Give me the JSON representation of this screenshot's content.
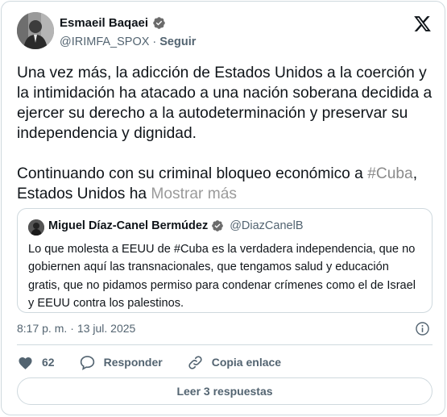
{
  "author": {
    "display_name": "Esmaeil Baqaei",
    "handle": "@IRIMFA_SPOX",
    "separator": "·",
    "follow_label": "Seguir"
  },
  "tweet": {
    "para1": "Una vez más, la adicción de Estados Unidos a la coerción y la intimidación ha atacado a una nación soberana decidida a ejercer su derecho a la autodeterminación y preservar su independencia y dignidad.",
    "para2_prefix": "Continuando con su criminal bloqueo económico a ",
    "para2_hashtag": "#Cuba",
    "para2_suffix": ", Estados Unidos ha ",
    "show_more": "Mostrar más"
  },
  "quote": {
    "display_name": "Miguel Díaz-Canel Bermúdez",
    "handle": "@DiazCanelB",
    "text": "Lo que molesta a EEUU de #Cuba es la verdadera independencia, que no gobiernen aquí las transnacionales, que tengamos salud y educación gratis, que no pidamos permiso para condenar crímenes como el de Israel y EEUU contra los palestinos."
  },
  "meta": {
    "time": "8:17 p. m.",
    "separator": "·",
    "date": "13 jul. 2025"
  },
  "actions": {
    "likes": "62",
    "reply_label": "Responder",
    "copy_label": "Copia enlace"
  },
  "read_replies": "Leer 3 respuestas",
  "colors": {
    "text": "#0f1419",
    "secondary": "#536471",
    "border": "#cfd9de",
    "verified_badge": "#6b6b6b"
  },
  "icons": [
    "verified-icon",
    "x-logo-icon",
    "info-icon",
    "heart-icon",
    "reply-bubble-icon",
    "link-icon"
  ]
}
